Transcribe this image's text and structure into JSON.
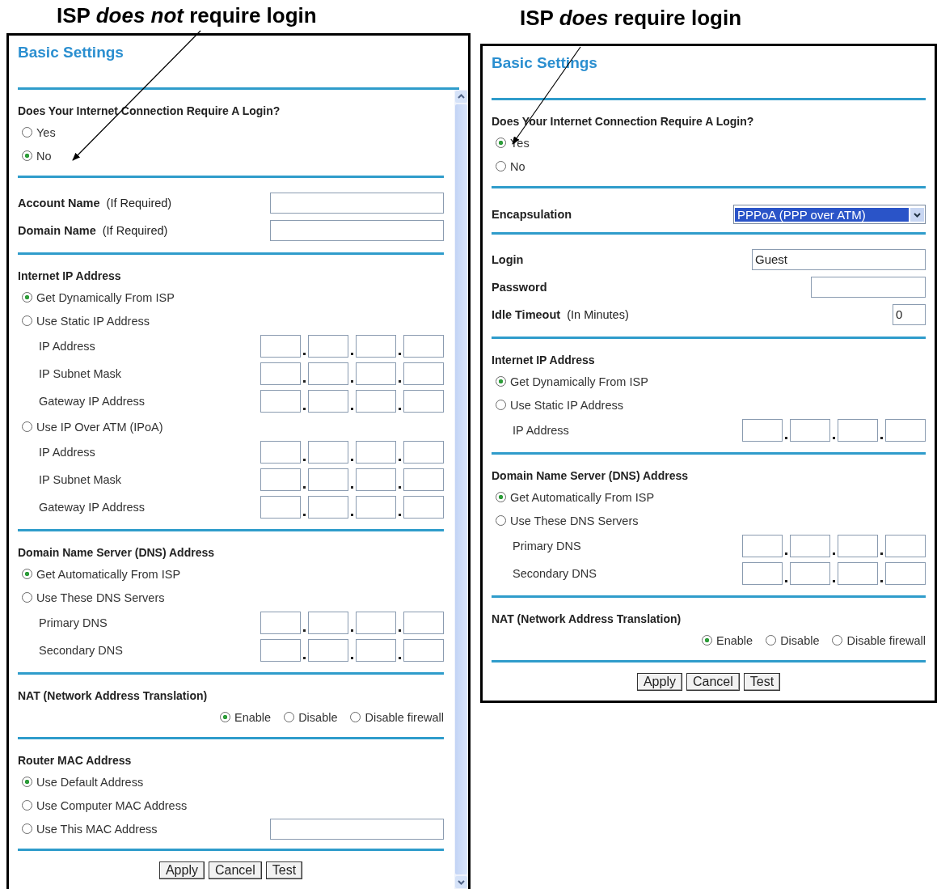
{
  "panels": [
    {
      "caption": "ISP *does not* require login",
      "title": "Basic Settings",
      "scrollbar": true,
      "sections": [
        {
          "heading": "Does Your Internet Connection Require A Login?",
          "rows": [
            {
              "kind": "radio",
              "label": "Yes",
              "selected": false
            },
            {
              "kind": "radio",
              "label": "No",
              "selected": true
            }
          ]
        },
        {
          "rows": [
            {
              "kind": "field",
              "label": "Account Name",
              "note": "(If Required)"
            },
            {
              "kind": "field",
              "label": "Domain Name",
              "note": "(If Required)"
            }
          ]
        },
        {
          "heading": "Internet IP Address",
          "rows": [
            {
              "kind": "radio",
              "label": "Get Dynamically From ISP",
              "selected": true
            },
            {
              "kind": "radio",
              "label": "Use Static IP Address",
              "selected": false
            },
            {
              "kind": "ip",
              "label": "IP Address"
            },
            {
              "kind": "ip",
              "label": "IP Subnet Mask"
            },
            {
              "kind": "ip",
              "label": "Gateway IP Address"
            },
            {
              "kind": "radio",
              "label": "Use IP Over ATM (IPoA)",
              "selected": false
            },
            {
              "kind": "ip",
              "label": "IP Address"
            },
            {
              "kind": "ip",
              "label": "IP Subnet Mask"
            },
            {
              "kind": "ip",
              "label": "Gateway IP Address"
            }
          ]
        },
        {
          "heading": "Domain Name Server (DNS) Address",
          "rows": [
            {
              "kind": "radio",
              "label": "Get Automatically From ISP",
              "selected": true
            },
            {
              "kind": "radio",
              "label": "Use These DNS Servers",
              "selected": false
            },
            {
              "kind": "ip",
              "label": "Primary DNS"
            },
            {
              "kind": "ip",
              "label": "Secondary DNS"
            }
          ]
        },
        {
          "heading": "NAT (Network Address Translation)",
          "rows": [
            {
              "kind": "choices",
              "options": [
                {
                  "label": "Enable",
                  "selected": true
                },
                {
                  "label": "Disable",
                  "selected": false
                },
                {
                  "label": "Disable firewall",
                  "selected": false
                }
              ]
            }
          ]
        },
        {
          "heading": "Router MAC Address",
          "rows": [
            {
              "kind": "radio",
              "label": "Use Default Address",
              "selected": true
            },
            {
              "kind": "radio",
              "label": "Use Computer MAC Address",
              "selected": false
            },
            {
              "kind": "radio-field",
              "label": "Use This MAC Address",
              "selected": false
            }
          ]
        }
      ],
      "buttons": [
        "Apply",
        "Cancel",
        "Test"
      ]
    },
    {
      "caption": "ISP *does* require login",
      "title": "Basic Settings",
      "scrollbar": false,
      "sections": [
        {
          "heading": "Does Your Internet Connection Require A Login?",
          "rows": [
            {
              "kind": "radio",
              "label": "Yes",
              "selected": true
            },
            {
              "kind": "radio",
              "label": "No",
              "selected": false
            }
          ]
        },
        {
          "rows": [
            {
              "kind": "select",
              "label": "Encapsulation",
              "value": "PPPoA (PPP over ATM)"
            }
          ]
        },
        {
          "rows": [
            {
              "kind": "field",
              "label": "Login",
              "value": "Guest"
            },
            {
              "kind": "short-field",
              "label": "Password"
            },
            {
              "kind": "number-field",
              "label": "Idle Timeout",
              "note": "(In Minutes)",
              "value": "0"
            }
          ]
        },
        {
          "heading": "Internet IP Address",
          "rows": [
            {
              "kind": "radio",
              "label": "Get Dynamically From ISP",
              "selected": true
            },
            {
              "kind": "radio",
              "label": "Use Static IP Address",
              "selected": false
            },
            {
              "kind": "ip",
              "label": "IP Address"
            }
          ]
        },
        {
          "heading": "Domain Name Server (DNS) Address",
          "rows": [
            {
              "kind": "radio",
              "label": "Get Automatically From ISP",
              "selected": true
            },
            {
              "kind": "radio",
              "label": "Use These DNS Servers",
              "selected": false
            },
            {
              "kind": "ip",
              "label": "Primary DNS"
            },
            {
              "kind": "ip",
              "label": "Secondary DNS"
            }
          ]
        },
        {
          "heading": "NAT (Network Address Translation)",
          "rows": [
            {
              "kind": "choices",
              "options": [
                {
                  "label": "Enable",
                  "selected": true
                },
                {
                  "label": "Disable",
                  "selected": false
                },
                {
                  "label": "Disable firewall",
                  "selected": false
                }
              ]
            }
          ]
        }
      ],
      "buttons": [
        "Apply",
        "Cancel",
        "Test"
      ]
    }
  ]
}
